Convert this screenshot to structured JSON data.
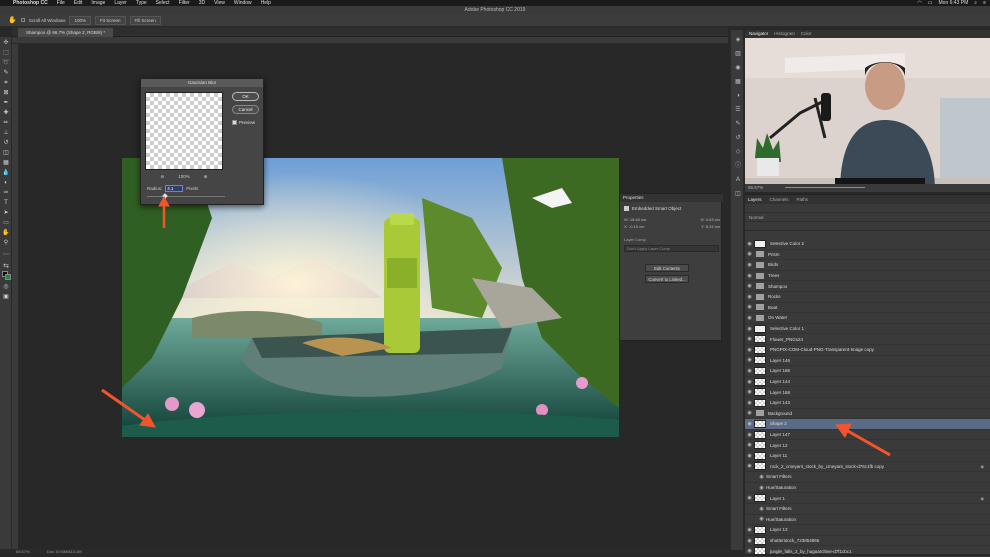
{
  "menubar": {
    "app": "Photoshop CC",
    "items": [
      "File",
      "Edit",
      "Image",
      "Layer",
      "Type",
      "Select",
      "Filter",
      "3D",
      "View",
      "Window",
      "Help"
    ],
    "clock": "Mon 6:43 PM"
  },
  "window_title": "Adobe Photoshop CC 2019",
  "options_bar": {
    "scroll_all": "Scroll All Windows",
    "zoom_100": "100%",
    "fit_screen": "Fit Screen",
    "fill_screen": "Fill Screen"
  },
  "document_tab": "Shampoo @ 66.7% (Shape 2, RGB/8) *",
  "status": {
    "zoom": "66.67%",
    "doc": "Doc: 5.93M/813.1M"
  },
  "navigator": {
    "tabs": [
      "Navigator",
      "Histogram",
      "Color"
    ],
    "zoom": "66.67%"
  },
  "layers_panel": {
    "tabs": [
      "Layers",
      "Channels",
      "Paths"
    ],
    "mode": "Normal",
    "layers": [
      {
        "name": "Selective Color 2",
        "type": "adjust"
      },
      {
        "name": "Prism",
        "type": "folder"
      },
      {
        "name": "Birds",
        "type": "folder"
      },
      {
        "name": "Trees",
        "type": "folder"
      },
      {
        "name": "Shampoo",
        "type": "folder"
      },
      {
        "name": "Rocks",
        "type": "folder"
      },
      {
        "name": "Boat",
        "type": "folder"
      },
      {
        "name": "On Water",
        "type": "folder"
      },
      {
        "name": "Selective Color 1",
        "type": "adjust"
      },
      {
        "name": "Flower_PNGs24",
        "type": "layer"
      },
      {
        "name": "PNGPIX-COM-Cloud-PNG-Transparent-Image copy",
        "type": "layer"
      },
      {
        "name": "Layer 146",
        "type": "layer"
      },
      {
        "name": "Layer 166",
        "type": "layer"
      },
      {
        "name": "Layer 144",
        "type": "layer"
      },
      {
        "name": "Layer 168",
        "type": "layer"
      },
      {
        "name": "Layer 143",
        "type": "layer"
      },
      {
        "name": "Background",
        "type": "folder"
      },
      {
        "name": "Shape 2",
        "type": "layer",
        "selected": true
      },
      {
        "name": "Layer 147",
        "type": "layer"
      },
      {
        "name": "Layer 12",
        "type": "layer"
      },
      {
        "name": "Layer 11",
        "type": "layer"
      },
      {
        "name": "rock_2_cmeyant_stock_by_cmeyant_stock-d76c1fb copy",
        "type": "layer",
        "fx": true
      },
      {
        "name": "Smart Filters",
        "type": "sub"
      },
      {
        "name": "Hue/Saturation",
        "type": "sub"
      },
      {
        "name": "Layer 1",
        "type": "layer",
        "fx": true
      },
      {
        "name": "Smart Filters",
        "type": "sub"
      },
      {
        "name": "Hue/Saturation",
        "type": "sub"
      },
      {
        "name": "Layer 13",
        "type": "layer"
      },
      {
        "name": "shutterstock_723854866",
        "type": "layer"
      },
      {
        "name": "jungle_falls_2_by_hugoarchive-d7f1cbc1",
        "type": "layer"
      }
    ]
  },
  "gaussian_blur": {
    "title": "Gaussian Blur",
    "ok": "OK",
    "cancel": "Cancel",
    "preview": "Preview",
    "zoom": "100%",
    "radius_label": "Radius:",
    "radius_value": "4.1",
    "radius_unit": "Pixels"
  },
  "properties": {
    "tab": "Properties",
    "type": "Embedded Smart Object",
    "w": "W: 18.60 cm",
    "h": "H: 0.63 cm",
    "x": "X: -0.15 cm",
    "y": "Y: 8.24 cm",
    "comps_label": "Layer Comp",
    "comps_placeholder": "Don't Apply Layer Comp",
    "edit_contents": "Edit Contents",
    "convert_linked": "Convert to Linked..."
  }
}
